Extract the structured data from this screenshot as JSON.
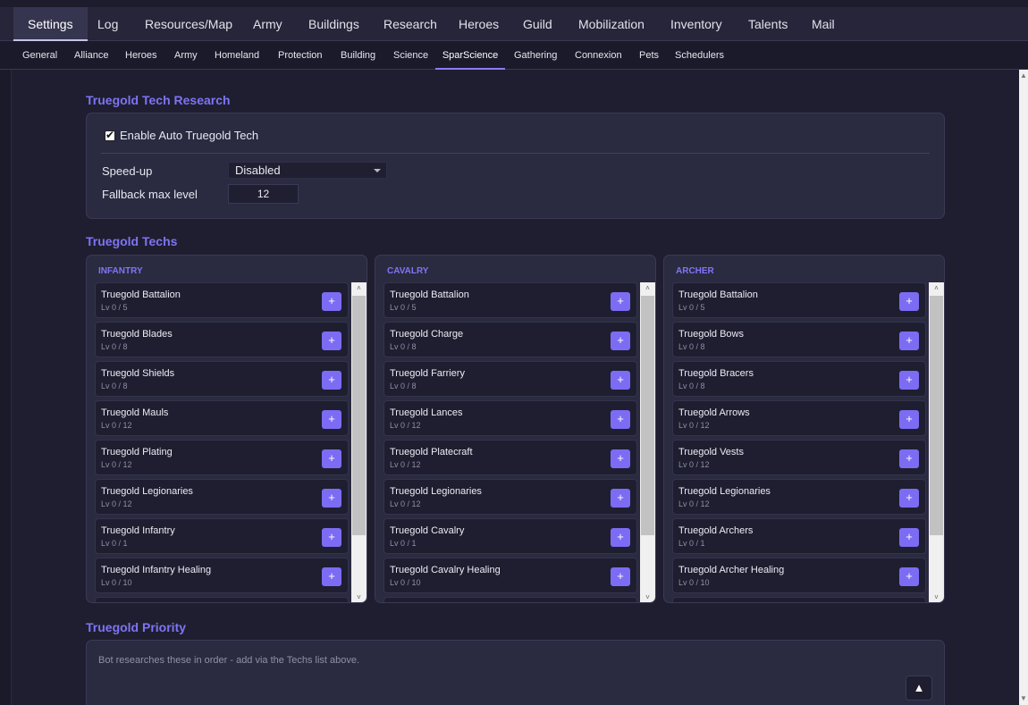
{
  "top_tabs": [
    "Settings",
    "Log",
    "Resources/Map",
    "Army",
    "Buildings",
    "Research",
    "Heroes",
    "Guild",
    "Mobilization",
    "Inventory",
    "Talents",
    "Mail"
  ],
  "sub_tabs": [
    "General",
    "Alliance",
    "Heroes",
    "Army",
    "Homeland",
    "Protection",
    "Building",
    "Science",
    "SparScience",
    "Gathering",
    "Connexion",
    "Pets",
    "Schedulers"
  ],
  "active_top_tab": "Settings",
  "active_sub_tab": "SparScience",
  "research": {
    "title": "Truegold Tech Research",
    "enable_label": "Enable Auto Truegold Tech",
    "enabled": true,
    "speedup_label": "Speed-up",
    "speedup_value": "Disabled",
    "fallback_label": "Fallback max level",
    "fallback_value": "12"
  },
  "techs": {
    "title": "Truegold Techs",
    "add_symbol": "+",
    "columns": [
      {
        "title": "INFANTRY",
        "items": [
          {
            "name": "Truegold Battalion",
            "level": "Lv 0 / 5"
          },
          {
            "name": "Truegold Blades",
            "level": "Lv 0 / 8"
          },
          {
            "name": "Truegold Shields",
            "level": "Lv 0 / 8"
          },
          {
            "name": "Truegold Mauls",
            "level": "Lv 0 / 12"
          },
          {
            "name": "Truegold Plating",
            "level": "Lv 0 / 12"
          },
          {
            "name": "Truegold Legionaries",
            "level": "Lv 0 / 12"
          },
          {
            "name": "Truegold Infantry",
            "level": "Lv 0 / 1"
          },
          {
            "name": "Truegold Infantry Healing",
            "level": "Lv 0 / 10"
          }
        ]
      },
      {
        "title": "CAVALRY",
        "items": [
          {
            "name": "Truegold Battalion",
            "level": "Lv 0 / 5"
          },
          {
            "name": "Truegold Charge",
            "level": "Lv 0 / 8"
          },
          {
            "name": "Truegold Farriery",
            "level": "Lv 0 / 8"
          },
          {
            "name": "Truegold Lances",
            "level": "Lv 0 / 12"
          },
          {
            "name": "Truegold Platecraft",
            "level": "Lv 0 / 12"
          },
          {
            "name": "Truegold Legionaries",
            "level": "Lv 0 / 12"
          },
          {
            "name": "Truegold Cavalry",
            "level": "Lv 0 / 1"
          },
          {
            "name": "Truegold Cavalry Healing",
            "level": "Lv 0 / 10"
          }
        ]
      },
      {
        "title": "ARCHER",
        "items": [
          {
            "name": "Truegold Battalion",
            "level": "Lv 0 / 5"
          },
          {
            "name": "Truegold Bows",
            "level": "Lv 0 / 8"
          },
          {
            "name": "Truegold Bracers",
            "level": "Lv 0 / 8"
          },
          {
            "name": "Truegold Arrows",
            "level": "Lv 0 / 12"
          },
          {
            "name": "Truegold Vests",
            "level": "Lv 0 / 12"
          },
          {
            "name": "Truegold Legionaries",
            "level": "Lv 0 / 12"
          },
          {
            "name": "Truegold Archers",
            "level": "Lv 0 / 1"
          },
          {
            "name": "Truegold Archer Healing",
            "level": "Lv 0 / 10"
          }
        ]
      }
    ]
  },
  "priority": {
    "title": "Truegold Priority",
    "hint": "Bot researches these in order - add via the Techs list above.",
    "top_button": "▲"
  },
  "colors": {
    "accent": "#7c6cf3",
    "background": "#1f1e30",
    "card": "#2a2a40"
  }
}
